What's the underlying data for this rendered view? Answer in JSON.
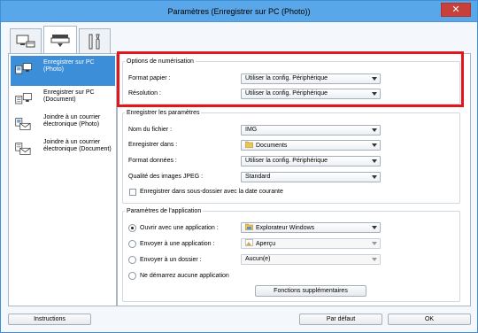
{
  "window": {
    "title": "Paramètres (Enregistrer sur PC (Photo))",
    "close_glyph": "✕"
  },
  "tabs": [
    {
      "icon": "scan-from-computer-icon"
    },
    {
      "icon": "scanner-panel-icon"
    },
    {
      "icon": "tools-icon"
    }
  ],
  "sidebar": {
    "items": [
      {
        "label": "Enregistrer sur PC (Photo)",
        "selected": true,
        "icon": "save-photo-icon"
      },
      {
        "label": "Enregistrer sur PC (Document)",
        "selected": false,
        "icon": "save-document-icon"
      },
      {
        "label": "Joindre à un courrier électronique (Photo)",
        "selected": false,
        "icon": "email-photo-icon"
      },
      {
        "label": "Joindre à un courrier électronique (Document)",
        "selected": false,
        "icon": "email-document-icon"
      }
    ]
  },
  "scan_options": {
    "legend": "Options de numérisation",
    "paper_format": {
      "label": "Format papier :",
      "value": "Utiliser la config. Périphérique"
    },
    "resolution": {
      "label": "Résolution :",
      "value": "Utiliser la config. Périphérique"
    }
  },
  "save_settings": {
    "legend": "Enregistrer les paramètres",
    "file_name": {
      "label": "Nom du fichier :",
      "value": "IMG"
    },
    "save_in": {
      "label": "Enregistrer dans :",
      "value": "Documents",
      "icon": "folder-icon"
    },
    "data_format": {
      "label": "Format données :",
      "value": "Utiliser la config. Périphérique"
    },
    "jpeg_quality": {
      "label": "Qualité des images JPEG :",
      "value": "Standard"
    },
    "subfolder_checkbox": {
      "label": "Enregistrer dans sous-dossier avec la date courante",
      "checked": false
    }
  },
  "app_settings": {
    "legend": "Paramètres de l'application",
    "open_app": {
      "label": "Ouvrir avec une application :",
      "value": "Explorateur Windows",
      "checked": true,
      "icon": "explorer-icon"
    },
    "send_app": {
      "label": "Envoyer à une application :",
      "value": "Aperçu",
      "checked": false,
      "icon": "preview-icon"
    },
    "send_folder": {
      "label": "Envoyer à un dossier :",
      "value": "Aucun(e)",
      "checked": false
    },
    "no_app": {
      "label": "Ne démarrez aucune application",
      "checked": false
    },
    "more_functions": "Fonctions supplémentaires"
  },
  "footer": {
    "instructions": "Instructions",
    "default": "Par défaut",
    "ok": "OK"
  },
  "colors": {
    "title_bar": "#59a7e8",
    "selected_item": "#3d8ed8",
    "highlight": "#e3161c"
  }
}
